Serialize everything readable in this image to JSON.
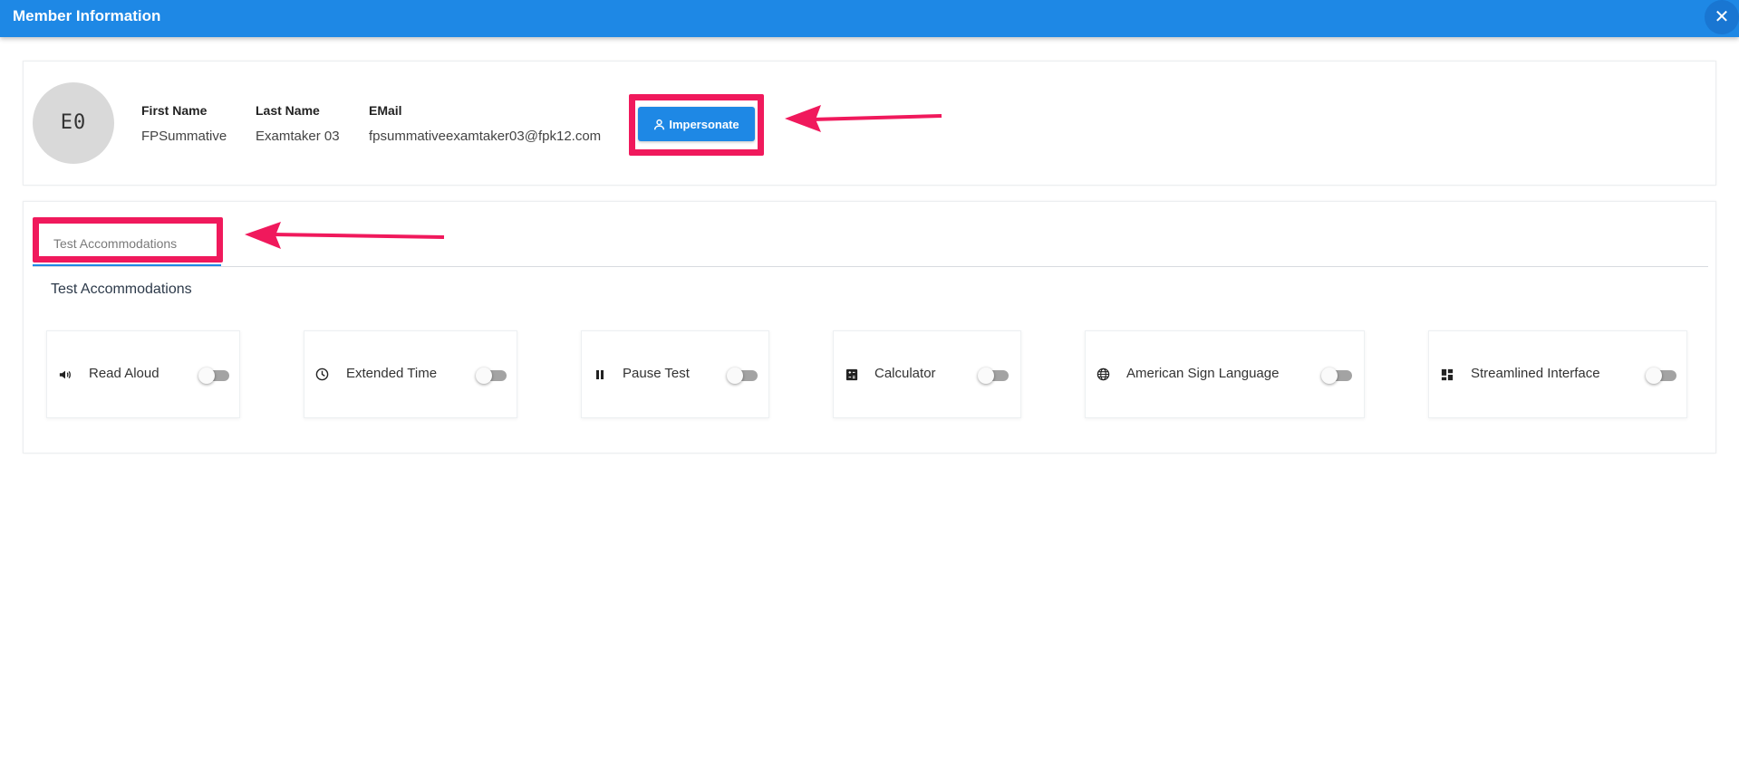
{
  "window": {
    "title": "Member Information",
    "close_icon": "close-icon"
  },
  "member": {
    "avatar_initials": "E0",
    "first_name_label": "First Name",
    "first_name": "FPSummative",
    "last_name_label": "Last Name",
    "last_name": "Examtaker 03",
    "email_label": "EMail",
    "email": "fpsummativeexamtaker03@fpk12.com",
    "impersonate_label": "Impersonate",
    "impersonate_icon": "person-icon"
  },
  "tabs": [
    {
      "label": "Test Accommodations",
      "active": true
    }
  ],
  "accommodations": {
    "title": "Test Accommodations",
    "items": [
      {
        "label": "Read Aloud",
        "icon": "speaker-icon",
        "enabled": false
      },
      {
        "label": "Extended Time",
        "icon": "clock-icon",
        "enabled": false
      },
      {
        "label": "Pause Test",
        "icon": "pause-icon",
        "enabled": false
      },
      {
        "label": "Calculator",
        "icon": "calculator-icon",
        "enabled": false
      },
      {
        "label": "American Sign Language",
        "icon": "globe-icon",
        "enabled": false
      },
      {
        "label": "Streamlined Interface",
        "icon": "dashboard-icon",
        "enabled": false
      }
    ]
  },
  "colors": {
    "primary": "#1e88e5",
    "highlight": "#f0195c",
    "toggle_off": "#a3a3a3"
  }
}
